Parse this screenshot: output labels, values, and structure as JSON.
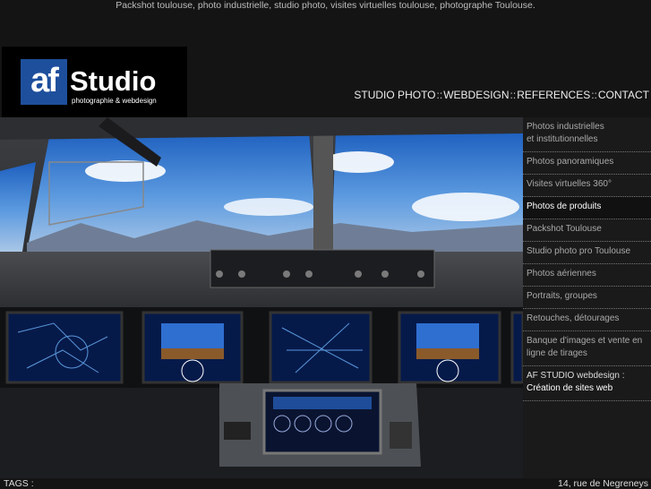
{
  "tagline": "Packshot toulouse, photo industrielle, studio photo, visites virtuelles toulouse, photographe Toulouse.",
  "logo": {
    "mark": "af",
    "name": "Studio",
    "sub": "photographie & webdesign"
  },
  "nav": {
    "items": [
      "STUDIO PHOTO",
      "WEBDESIGN",
      "REFERENCES",
      "CONTACT"
    ],
    "separator": "::"
  },
  "sidebar": {
    "items": [
      {
        "line1": "Photos industrielles",
        "line2": "et institutionnelles"
      },
      {
        "line1": "Photos panoramiques"
      },
      {
        "line1": "Visites virtuelles 360°"
      },
      {
        "line1": "Photos de produits"
      },
      {
        "line1": "Packshot Toulouse"
      },
      {
        "line1": "Studio photo pro Toulouse"
      },
      {
        "line1": "Photos aériennes"
      },
      {
        "line1": "Portraits, groupes"
      },
      {
        "line1": "Retouches, détourages"
      },
      {
        "line1": "Banque d'images et vente en",
        "line2": "ligne de tirages"
      },
      {
        "line1": "AF STUDIO webdesign :",
        "line2": "Création de sites web"
      }
    ],
    "active_index": 3
  },
  "footer": {
    "tags": "TAGS :",
    "address": "14, rue de Negreneys"
  },
  "colors": {
    "logo_blue": "#1e4f9c",
    "background": "#141414",
    "sidebar": "#1a1a1a"
  }
}
